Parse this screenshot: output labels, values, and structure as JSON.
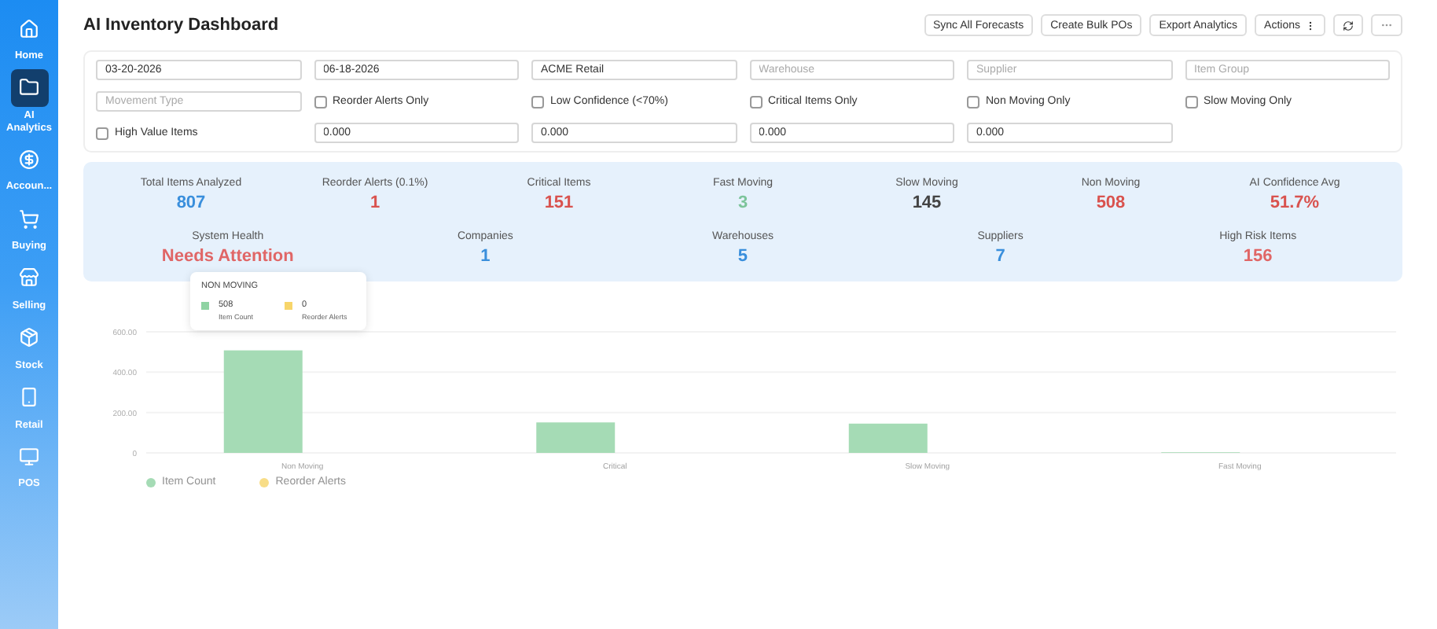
{
  "sidebar": {
    "items": [
      {
        "label": "Home",
        "selected": false
      },
      {
        "label": "AI Analytics",
        "selected": true
      },
      {
        "label": "Accoun...",
        "selected": false
      },
      {
        "label": "Buying",
        "selected": false
      },
      {
        "label": "Selling",
        "selected": false
      },
      {
        "label": "Stock",
        "selected": false
      },
      {
        "label": "Retail",
        "selected": false
      },
      {
        "label": "POS",
        "selected": false
      }
    ]
  },
  "header": {
    "title": "AI Inventory Dashboard",
    "buttons": [
      {
        "kind": "text",
        "label": "Sync All Forecasts"
      },
      {
        "kind": "text",
        "label": "Create Bulk POs"
      },
      {
        "kind": "text",
        "label": "Export Analytics"
      },
      {
        "kind": "menu",
        "label": "Actions"
      },
      {
        "kind": "refresh"
      },
      {
        "kind": "more"
      }
    ]
  },
  "filters": [
    {
      "kind": "input",
      "value": "03-20-2026"
    },
    {
      "kind": "input",
      "value": "06-18-2026"
    },
    {
      "kind": "input",
      "value": "ACME Retail"
    },
    {
      "kind": "input",
      "placeholder": "Warehouse"
    },
    {
      "kind": "input",
      "placeholder": "Supplier"
    },
    {
      "kind": "input",
      "placeholder": "Item Group"
    },
    {
      "kind": "input",
      "placeholder": "Movement Type"
    },
    {
      "kind": "checkbox",
      "label": "Reorder Alerts Only",
      "checked": false
    },
    {
      "kind": "checkbox",
      "label": "Low Confidence (<70%)",
      "checked": false
    },
    {
      "kind": "checkbox",
      "label": "Critical Items Only",
      "checked": false
    },
    {
      "kind": "checkbox",
      "label": "Non Moving Only",
      "checked": false
    },
    {
      "kind": "checkbox",
      "label": "Slow Moving Only",
      "checked": false
    },
    {
      "kind": "checkbox",
      "label": "High Value Items",
      "checked": false
    },
    {
      "kind": "input",
      "value": "0.000"
    },
    {
      "kind": "input",
      "value": "0.000"
    },
    {
      "kind": "input",
      "value": "0.000"
    },
    {
      "kind": "input",
      "value": "0.000"
    }
  ],
  "stats": {
    "primary": [
      {
        "label": "Total Items Analyzed",
        "value": "807",
        "color": "#3a8fdc"
      },
      {
        "label": "Reorder Alerts (0.1%)",
        "value": "1",
        "color": "#d9534f"
      },
      {
        "label": "Critical Items",
        "value": "151",
        "color": "#d9534f"
      },
      {
        "label": "Fast Moving",
        "value": "3",
        "color": "#7cc49a"
      },
      {
        "label": "Slow Moving",
        "value": "145",
        "color": "#444444"
      },
      {
        "label": "Non Moving",
        "value": "508",
        "color": "#d9534f"
      },
      {
        "label": "AI Confidence Avg",
        "value": "51.7%",
        "color": "#d9534f"
      }
    ],
    "secondary": [
      {
        "label": "System Health",
        "value": "Needs Attention",
        "color": "#e06666"
      },
      {
        "label": "Companies",
        "value": "1",
        "color": "#3a8fdc"
      },
      {
        "label": "Warehouses",
        "value": "5",
        "color": "#3a8fdc"
      },
      {
        "label": "Suppliers",
        "value": "7",
        "color": "#3a8fdc"
      },
      {
        "label": "High Risk Items",
        "value": "156",
        "color": "#e06666"
      }
    ]
  },
  "chart": {
    "chart_data": {
      "type": "bar",
      "categories": [
        "Non Moving",
        "Critical",
        "Slow Moving",
        "Fast Moving"
      ],
      "series": [
        {
          "name": "Item Count",
          "color": "#8fd3a3",
          "values": [
            508,
            151,
            145,
            3
          ]
        },
        {
          "name": "Reorder Alerts",
          "color": "#f7d56a",
          "values": [
            0,
            0,
            0,
            0
          ]
        }
      ],
      "ylim": [
        0,
        600
      ],
      "yticks": [
        {
          "value": 0,
          "label": "0"
        },
        {
          "value": 200,
          "label": "200.00"
        },
        {
          "value": 400,
          "label": "400.00"
        },
        {
          "value": 600,
          "label": "600.00"
        }
      ]
    },
    "tooltip": {
      "title": "NON MOVING",
      "entries": [
        {
          "value": "508",
          "name": "Item Count",
          "color": "#8fd3a3"
        },
        {
          "value": "0",
          "name": "Reorder Alerts",
          "color": "#f7d56a"
        }
      ]
    }
  }
}
